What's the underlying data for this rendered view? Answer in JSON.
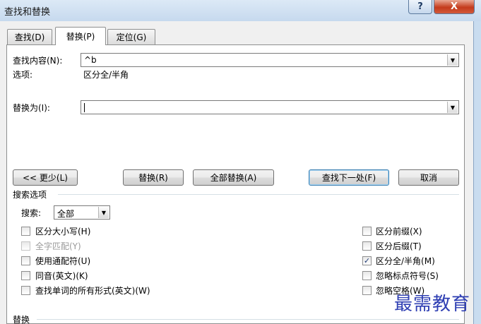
{
  "window": {
    "title": "查找和替换",
    "help_label": "?",
    "close_label": "X"
  },
  "tabs": [
    {
      "label": "查找(D)"
    },
    {
      "label": "替换(P)"
    },
    {
      "label": "定位(G)"
    }
  ],
  "find": {
    "label": "查找内容(N):",
    "value": "^b",
    "options_label": "选项:",
    "options_value": "区分全/半角"
  },
  "replace": {
    "label": "替换为(I):",
    "value": ""
  },
  "buttons": {
    "less": "<< 更少(L)",
    "replace": "替换(R)",
    "replace_all": "全部替换(A)",
    "find_next": "查找下一处(F)",
    "cancel": "取消"
  },
  "search_options": {
    "title": "搜索选项",
    "search_label": "搜索:",
    "search_value": "全部",
    "left": [
      {
        "label": "区分大小写(H)",
        "checked": false,
        "disabled": false
      },
      {
        "label": "全字匹配(Y)",
        "checked": false,
        "disabled": true
      },
      {
        "label": "使用通配符(U)",
        "checked": false,
        "disabled": false
      },
      {
        "label": "同音(英文)(K)",
        "checked": false,
        "disabled": false
      },
      {
        "label": "查找单词的所有形式(英文)(W)",
        "checked": false,
        "disabled": false
      }
    ],
    "right": [
      {
        "label": "区分前缀(X)",
        "checked": false
      },
      {
        "label": "区分后缀(T)",
        "checked": false
      },
      {
        "label": "区分全/半角(M)",
        "checked": true
      },
      {
        "label": "忽略标点符号(S)",
        "checked": false
      },
      {
        "label": "忽略空格(W)",
        "checked": false
      }
    ]
  },
  "replace_section": {
    "title": "替换"
  },
  "watermark": "最需教育"
}
